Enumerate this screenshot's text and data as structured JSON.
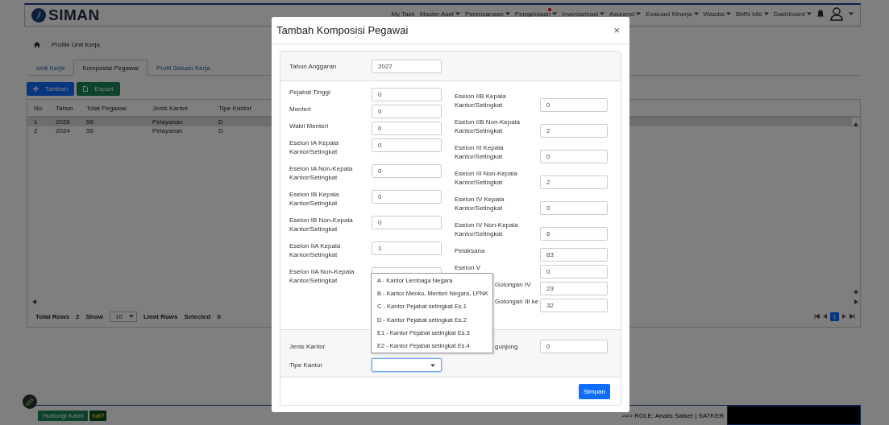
{
  "header": {
    "logo": "SIMAN",
    "nav": [
      {
        "label": "My Task",
        "menu": false,
        "notify": false
      },
      {
        "label": "Master Aset",
        "menu": true,
        "notify": false
      },
      {
        "label": "Perencanaan",
        "menu": true,
        "notify": false
      },
      {
        "label": "Pengelolaan",
        "menu": true,
        "notify": true
      },
      {
        "label": "Inventarisasi",
        "menu": true,
        "notify": false
      },
      {
        "label": "Asuransi",
        "menu": true,
        "notify": false
      },
      {
        "label": "Evaluasi Kinerja",
        "menu": true,
        "notify": false
      },
      {
        "label": "Wasdal",
        "menu": true,
        "notify": false
      },
      {
        "label": "BMN Idle",
        "menu": true,
        "notify": false
      },
      {
        "label": "Dashboard",
        "menu": true,
        "notify": false
      }
    ]
  },
  "breadcrumb": "Profile Unit Kerja",
  "tabs": [
    {
      "label": "Unit Kerja",
      "selected": false
    },
    {
      "label": "Komposisi Pegawai",
      "selected": true
    },
    {
      "label": "Profil Satuan Kerja",
      "selected": false
    }
  ],
  "actions": [
    {
      "label": "Tambah",
      "kind": "add"
    },
    {
      "label": "Export",
      "kind": "export"
    }
  ],
  "table": {
    "columns": [
      "No",
      "Tahun",
      "Total Pegawai",
      "Jenis Kantor",
      "Tipe Kantor"
    ],
    "rows": [
      {
        "cells": [
          "1",
          "2026",
          "56",
          "Pelayanan",
          "D"
        ],
        "selected": true
      },
      {
        "cells": [
          "2",
          "2024",
          "56",
          "Pelayanan",
          "D"
        ],
        "selected": false
      }
    ],
    "total_label": "Total Rows",
    "total": "2",
    "show_label": "Show",
    "show_value": "10",
    "limit_label": "Limit Rows",
    "selected_label": "Selected",
    "selected_count": "0",
    "pages": [
      {
        "label": "1",
        "selected": true
      }
    ]
  },
  "footer": {
    "contact": "Hubungi Kami",
    "badge": "hal?",
    "status": ">>> ROLE: Analis Satker |  SATKER"
  },
  "modal": {
    "title": "Tambah Komposisi Pegawai",
    "close": "×",
    "year": {
      "label": "Tahun Anggaran",
      "value": "2027"
    },
    "left_fields": [
      {
        "label": "Pejabat Tinggi",
        "value": "0"
      },
      {
        "label": "Menteri",
        "value": "0"
      },
      {
        "label": "Wakil Menteri",
        "value": "0"
      },
      {
        "label": "Eselon IA Kepala Kantor/Setingkat",
        "value": "0"
      },
      {
        "label": "Eselon IA Non-Kepala Kantor/Setingkat",
        "value": "0"
      },
      {
        "label": "Eselon IB Kepala Kantor/Setingkat",
        "value": "0"
      },
      {
        "label": "Eselon IB Non-Kepala Kantor/Setingkat",
        "value": "0"
      },
      {
        "label": "Eselon IIA Kepala Kantor/Setingkat",
        "value": "1"
      },
      {
        "label": "Eselon IIA Non-Kepala Kantor/Setingkat"
      }
    ],
    "right_fields": [
      {
        "label": "Eselon IIB Kepala Kantor/Setingkat",
        "value": "0",
        "covered": false
      },
      {
        "label": "Eselon IIB Non-Kepala Kantor/Setingkat",
        "value": "2",
        "covered": false
      },
      {
        "label": "Eselon III Kepala Kantor/Setingkat",
        "value": "0",
        "covered": false
      },
      {
        "label": "Eselon III Non-Kepala Kantor/Setingkat",
        "value": "2",
        "covered": false
      },
      {
        "label": "Eselon IV Kepala Kantor/Setingkat",
        "value": "0",
        "covered": false
      },
      {
        "label": "Eselon IV Non-Kepala Kantor/Setingkat",
        "value": "6",
        "covered": false
      },
      {
        "label": "Pelaksana",
        "value": "83",
        "covered": false
      },
      {
        "label": "Eselon V",
        "value": "0",
        "covered": false
      },
      {
        "label": "Golongan IV",
        "value": "23",
        "covered": true
      },
      {
        "label": "Golongan III ke",
        "value": "32",
        "covered": true
      }
    ],
    "bottom_left": [
      {
        "label": "Jenis Kantor"
      },
      {
        "label": "Tipe Kantor",
        "select": {
          "focused": true
        }
      }
    ],
    "bottom_right": [
      {
        "label": "gunjung",
        "value": "0",
        "covered": true
      }
    ],
    "options": [
      "A - Kantor Lembaga Negara",
      "B - Kantor Menko, Menteri Negara, LPNK",
      "C - Kantor Pejabat setingkat Es.1",
      "D - Kantor Pejabat setingkat Es.2",
      "E1 - Kantor Pejabat setingkat Es.3",
      "E2 - Kantor Pejabat setingkat Es.4"
    ],
    "save": "Simpan"
  }
}
